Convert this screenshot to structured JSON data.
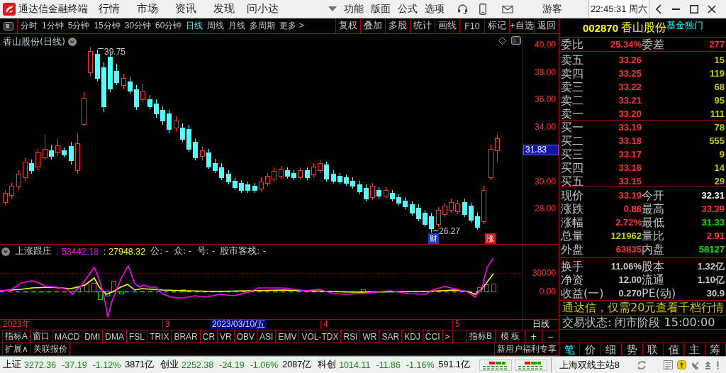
{
  "title_bar": {
    "app_name": "通达信金融终端",
    "menus": [
      "行情",
      "市场",
      "资讯",
      "发现",
      "问小达"
    ],
    "menus_right": [
      "功能",
      "版面",
      "公式",
      "选项"
    ],
    "user": "游客",
    "clock": "22:45:31 周六"
  },
  "period_bar": {
    "periods": [
      {
        "label": "分时",
        "selected": false
      },
      {
        "label": "1分钟",
        "selected": false
      },
      {
        "label": "5分钟",
        "selected": false
      },
      {
        "label": "15分钟",
        "selected": false
      },
      {
        "label": "30分钟",
        "selected": false
      },
      {
        "label": "60分钟",
        "selected": false
      },
      {
        "label": "日线",
        "selected": true
      },
      {
        "label": "周线",
        "selected": false
      },
      {
        "label": "月线",
        "selected": false
      },
      {
        "label": "多周期",
        "selected": false
      }
    ],
    "more": "更多 >",
    "tools": [
      "复权",
      "叠加",
      "多股",
      "统计",
      "画线",
      "F10",
      "标记",
      "+自选",
      "返回"
    ]
  },
  "price_chart": {
    "title": "香山股份(日线)",
    "ticks": [
      "40.00",
      "38.00",
      "36.00",
      "34.00",
      "30.00",
      "28.00"
    ],
    "price_tag": "31.83",
    "high_label": "39.75",
    "low_label": "26.27",
    "badges": [
      {
        "text": "财",
        "color": "#1e3cc8"
      },
      {
        "text": "涨",
        "color": "#c81e1e"
      }
    ]
  },
  "indicator_panel": {
    "name": "上涨跟庄",
    "values": [
      {
        "text": ": 53442.18",
        "color": "#ff00ff"
      },
      {
        "text": ": 27948.32",
        "color": "#ffff00"
      }
    ],
    "fields": [
      "公: -",
      "众: -",
      "号: -",
      "股市客栈: -"
    ],
    "ticks": [
      "30000",
      "0.00"
    ]
  },
  "date_axis": {
    "labels": [
      "2023年",
      "3",
      "4",
      "5"
    ],
    "cursor_date": "2023/03/10/五",
    "period": "日线"
  },
  "indicator_tabs": {
    "tabs": [
      "指标A",
      "窗口",
      "MACD",
      "DMI",
      "DMA",
      "FSL",
      "TRIX",
      "BRAR",
      "CR",
      "VR",
      "OBV",
      "ASI",
      "EMV",
      "VOL-TDX",
      "RSI",
      "WR",
      "SAR",
      "KDJ",
      "CCI",
      ">"
    ],
    "group_b": "指标B",
    "template": "模 板",
    "zoom_in": "+",
    "zoom_out": "−"
  },
  "extra_bar": {
    "links": [
      "扩展∧",
      "关联报价"
    ],
    "promo": "新用户福利专享"
  },
  "quote_panel": {
    "code": "002870",
    "name": "香山股份",
    "tag": "基金独门",
    "ratio": [
      {
        "label": "委比",
        "value": "25.34%"
      },
      {
        "label": "委差",
        "value": "277"
      }
    ],
    "asks": [
      {
        "label": "卖五",
        "price": "33.26",
        "volume": "15"
      },
      {
        "label": "卖四",
        "price": "33.25",
        "volume": "119"
      },
      {
        "label": "卖三",
        "price": "33.22",
        "volume": "68"
      },
      {
        "label": "卖二",
        "price": "33.21",
        "volume": "95"
      },
      {
        "label": "卖一",
        "price": "33.20",
        "volume": "111"
      }
    ],
    "bids": [
      {
        "label": "买一",
        "price": "33.19",
        "volume": "78"
      },
      {
        "label": "买二",
        "price": "33.18",
        "volume": "555"
      },
      {
        "label": "买三",
        "price": "33.17",
        "volume": "9"
      },
      {
        "label": "买四",
        "price": "33.16",
        "volume": "14"
      },
      {
        "label": "买五",
        "price": "33.15",
        "volume": "29"
      }
    ],
    "stats": [
      {
        "label": "现价",
        "value": "33.19",
        "color": "#ff3232"
      },
      {
        "label": "今开",
        "value": "32.31",
        "color": "#ffffff"
      },
      {
        "label": "涨跌",
        "value": "0.88",
        "color": "#ff3232"
      },
      {
        "label": "最高",
        "value": "33.39",
        "color": "#ff3232"
      },
      {
        "label": "涨幅",
        "value": "2.72%",
        "color": "#ff3232"
      },
      {
        "label": "最低",
        "value": "31.33",
        "color": "#00e600"
      },
      {
        "label": "总量",
        "value": "121962",
        "color": "#c8c800"
      },
      {
        "label": "量比",
        "value": "2.91",
        "color": "#ff3232"
      },
      {
        "label": "外盘",
        "value": "63835",
        "color": "#ff3232"
      },
      {
        "label": "内盘",
        "value": "58127",
        "color": "#00e600"
      }
    ],
    "fundamentals": [
      {
        "label": "换手",
        "value": "11.06%"
      },
      {
        "label": "股本",
        "value": "1.32亿"
      },
      {
        "label": "净资",
        "value": "12.00"
      },
      {
        "label": "流通",
        "value": "1.10亿"
      },
      {
        "label": "收益(一)",
        "value": "0.270"
      },
      {
        "label": "PE(动)",
        "value": "30.9"
      }
    ],
    "promo": "通达信，仅需20元查看千档行情",
    "trade_status": "交易状态: 闭市阶段 15:00:00",
    "tabs": [
      {
        "label": "笔",
        "selected": true
      },
      {
        "label": "价",
        "selected": false
      },
      {
        "label": "细",
        "selected": false
      },
      {
        "label": "势",
        "selected": false
      },
      {
        "label": "联",
        "selected": false
      },
      {
        "label": "值",
        "selected": false
      },
      {
        "label": "主",
        "selected": false
      },
      {
        "label": "筹",
        "selected": false
      }
    ]
  },
  "status_bar": {
    "indices": [
      {
        "name": "上证",
        "price": "3272.36",
        "change": "-37.19",
        "percent": "-1.12%",
        "amount": "3871亿"
      },
      {
        "name": "创业",
        "price": "2252.38",
        "change": "-24.19",
        "percent": "-1.06%",
        "amount": "2087亿"
      },
      {
        "name": "科创",
        "price": "1014.11",
        "change": "-11.86",
        "percent": "-1.16%",
        "amount": "591.1亿"
      }
    ],
    "server": "上海双线主站8"
  }
}
